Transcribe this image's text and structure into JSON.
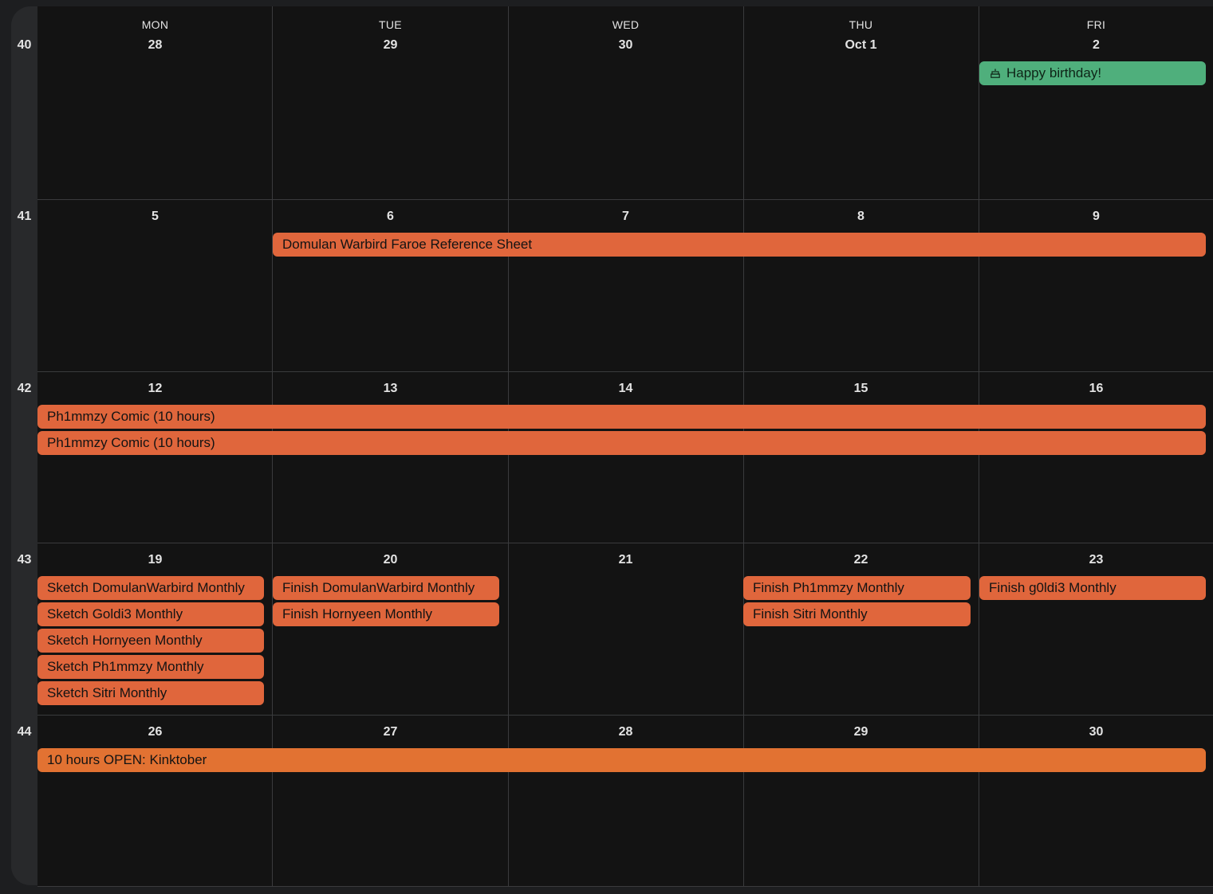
{
  "days_of_week": [
    "MON",
    "TUE",
    "WED",
    "THU",
    "FRI"
  ],
  "weeks": [
    {
      "number": "40",
      "days": [
        "28",
        "29",
        "30",
        "Oct 1",
        "2"
      ]
    },
    {
      "number": "41",
      "days": [
        "5",
        "6",
        "7",
        "8",
        "9"
      ]
    },
    {
      "number": "42",
      "days": [
        "12",
        "13",
        "14",
        "15",
        "16"
      ]
    },
    {
      "number": "43",
      "days": [
        "19",
        "20",
        "21",
        "22",
        "23"
      ]
    },
    {
      "number": "44",
      "days": [
        "26",
        "27",
        "28",
        "29",
        "30"
      ]
    }
  ],
  "events": {
    "birthday": "Happy birthday!",
    "domulan_ref": "Domulan Warbird Faroe Reference Sheet",
    "ph1mmzy_comic_1": "Ph1mmzy Comic (10 hours)",
    "ph1mmzy_comic_2": "Ph1mmzy Comic (10 hours)",
    "sketch_domulan": "Sketch DomulanWarbird Monthly",
    "sketch_goldi3": "Sketch Goldi3 Monthly",
    "sketch_hornyeen": "Sketch Hornyeen Monthly",
    "sketch_ph1mmzy": "Sketch Ph1mmzy Monthly",
    "sketch_sitri": "Sketch Sitri Monthly",
    "finish_domulan": "Finish DomulanWarbird Monthly",
    "finish_hornyeen": "Finish Hornyeen Monthly",
    "finish_ph1mmzy": "Finish Ph1mmzy Monthly",
    "finish_sitri": "Finish Sitri Monthly",
    "finish_goldi3": "Finish g0ldi3 Monthly",
    "kinktober": "10 hours OPEN: Kinktober"
  },
  "colors": {
    "event_orange": "#e0663c",
    "event_orange_alt": "#e27232",
    "event_green": "#4faf7c",
    "background": "#131313"
  },
  "icons": {
    "birthday": "cake-icon"
  }
}
